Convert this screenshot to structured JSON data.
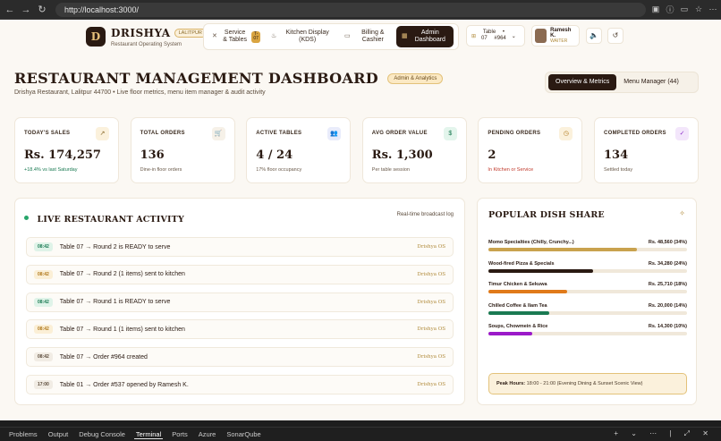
{
  "browser": {
    "url": "http://localhost:3000/",
    "back": "←",
    "forward": "→",
    "reload": "↻"
  },
  "brand": {
    "logo": "D",
    "name": "DRISHYA",
    "badge": "LALITPUR",
    "subtitle": "Restaurant Operating System"
  },
  "nav": {
    "service": "Service & Tables",
    "service_badge": "T-07",
    "kds": "Kitchen Display (KDS)",
    "billing": "Billing & Cashier",
    "admin": "Admin Dashboard"
  },
  "table_selector": {
    "label": "Table",
    "table": "07",
    "order_sym": "•",
    "order": "#964"
  },
  "user": {
    "name": "Ramesh K.",
    "role": "WAITER"
  },
  "header": {
    "title": "RESTAURANT MANAGEMENT DASHBOARD",
    "badge": "Admin & Analytics",
    "subtitle": "Drishya Restaurant, Lalitpur 44700 • Live floor metrics, menu item manager & audit activity"
  },
  "tabs": {
    "overview": "Overview & Metrics",
    "menu": "Menu Manager (44)"
  },
  "stats": [
    {
      "label": "TODAY'S SALES",
      "value": "Rs. 174,257",
      "note": "+18.4% vs last Saturday",
      "icon": "trend-icon",
      "glyph": "↗"
    },
    {
      "label": "TOTAL ORDERS",
      "value": "136",
      "note": "Dine-in floor orders",
      "icon": "cart-icon",
      "glyph": "🛒"
    },
    {
      "label": "ACTIVE TABLES",
      "value": "4 / 24",
      "note": "17% floor occupancy",
      "icon": "users-icon",
      "glyph": "👥"
    },
    {
      "label": "AVG ORDER VALUE",
      "value": "Rs. 1,300",
      "note": "Per table session",
      "icon": "dollar-icon",
      "glyph": "$"
    },
    {
      "label": "PENDING ORDERS",
      "value": "2",
      "note": "In Kitchen or Service",
      "icon": "clock-icon",
      "glyph": "◷"
    },
    {
      "label": "COMPLETED ORDERS",
      "value": "134",
      "note": "Settled today",
      "icon": "check-circle-icon",
      "glyph": "✓"
    }
  ],
  "activity": {
    "title": "LIVE RESTAURANT ACTIVITY",
    "caption": "Real-time broadcast log",
    "rows": [
      {
        "time": "08:42",
        "text": "Table 07 → Round 2 is READY to serve",
        "source": "Drishya OS"
      },
      {
        "time": "08:42",
        "text": "Table 07 → Round 2 (1 items) sent to kitchen",
        "source": "Drishya OS"
      },
      {
        "time": "08:42",
        "text": "Table 07 → Round 1 is READY to serve",
        "source": "Drishya OS"
      },
      {
        "time": "08:42",
        "text": "Table 07 → Round 1 (1 items) sent to kitchen",
        "source": "Drishya OS"
      },
      {
        "time": "08:42",
        "text": "Table 07 → Order #964 created",
        "source": "Drishya OS"
      },
      {
        "time": "17:00",
        "text": "Table 01 → Order #537 opened by Ramesh K.",
        "source": "Drishya OS"
      }
    ]
  },
  "dishes": {
    "title": "POPULAR DISH SHARE",
    "items": [
      {
        "name": "Momo Specialties (Chilly, Crunchy...)",
        "amount": "Rs. 48,560 (34%)",
        "share": 34,
        "color": "#c9a24e"
      },
      {
        "name": "Wood-fired Pizza & Specials",
        "amount": "Rs. 34,280 (24%)",
        "share": 24,
        "color": "#2a1a12"
      },
      {
        "name": "Timur Chicken & Sekuwa",
        "amount": "Rs. 25,710 (18%)",
        "share": 18,
        "color": "#e07a1a"
      },
      {
        "name": "Chilled Coffee & Ilam Tea",
        "amount": "Rs. 20,000 (14%)",
        "share": 14,
        "color": "#1a7a52"
      },
      {
        "name": "Soups, Chowmein & Rice",
        "amount": "Rs. 14,300 (10%)",
        "share": 10,
        "color": "#9b1ac9"
      }
    ],
    "peak_label": "Peak Hours:",
    "peak_value": "18:00 - 21:00 (Evening Dining & Sunset Scenic View)"
  },
  "panel_tabs": [
    "Problems",
    "Output",
    "Debug Console",
    "Terminal",
    "Ports",
    "Azure",
    "SonarQube"
  ],
  "panel_tools": "+ ⌄ ⋯ | ⤢ ✕"
}
